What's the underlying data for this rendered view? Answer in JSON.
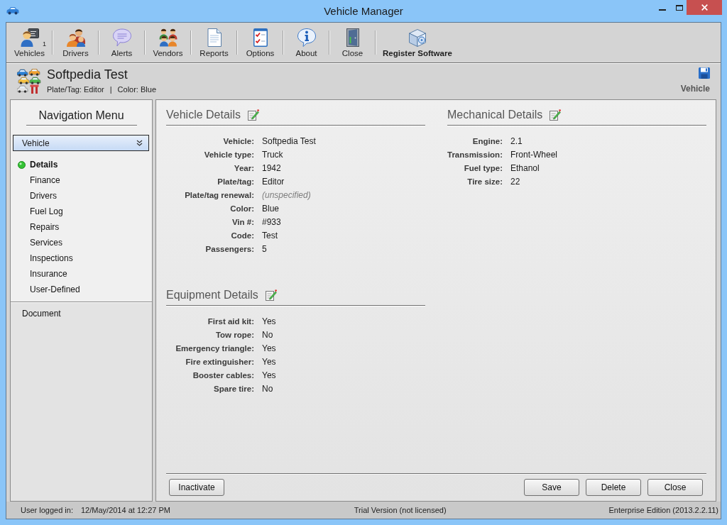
{
  "window": {
    "title": "Vehicle Manager"
  },
  "toolbar": [
    {
      "label": "Vehicles",
      "badge": "1",
      "emphasized": false
    },
    {
      "label": "Drivers",
      "emphasized": false
    },
    {
      "label": "Alerts",
      "emphasized": false
    },
    {
      "label": "Vendors",
      "emphasized": false
    },
    {
      "label": "Reports",
      "emphasized": false
    },
    {
      "label": "Options",
      "emphasized": false
    },
    {
      "label": "About",
      "emphasized": false
    },
    {
      "label": "Close",
      "emphasized": false
    },
    {
      "label": "Register Software",
      "emphasized": true
    }
  ],
  "header": {
    "title": "Softpedia Test",
    "details": [
      "Plate/Tag: Editor",
      "Color: Blue"
    ],
    "separator": "|",
    "context": "Vehicle"
  },
  "sidebar": {
    "title": "Navigation Menu",
    "dropdown": {
      "value": "Vehicle"
    },
    "items": [
      {
        "label": "Details",
        "selected": true
      },
      {
        "label": "Finance",
        "selected": false
      },
      {
        "label": "Drivers",
        "selected": false
      },
      {
        "label": "Fuel Log",
        "selected": false
      },
      {
        "label": "Repairs",
        "selected": false
      },
      {
        "label": "Services",
        "selected": false
      },
      {
        "label": "Inspections",
        "selected": false
      },
      {
        "label": "Insurance",
        "selected": false
      },
      {
        "label": "User-Defined",
        "selected": false
      }
    ],
    "footer_items": [
      {
        "label": "Document",
        "selected": false
      }
    ]
  },
  "detail_columns": [
    {
      "sections": [
        {
          "title": "Vehicle Details",
          "fields": [
            {
              "label": "Vehicle:",
              "value": "Softpedia Test",
              "kind": "value"
            },
            {
              "label": "Vehicle type:",
              "value": "Truck",
              "kind": "value"
            },
            {
              "label": "Year:",
              "value": "1942",
              "kind": "value"
            },
            {
              "label": "Plate/tag:",
              "value": "Editor",
              "kind": "value"
            },
            {
              "label": "Plate/tag renewal:",
              "value": "(unspecified)",
              "kind": "unset"
            },
            {
              "label": "Color:",
              "value": "Blue",
              "kind": "value"
            },
            {
              "label": "Vin #:",
              "value": "#933",
              "kind": "value"
            },
            {
              "label": "Code:",
              "value": "Test",
              "kind": "value"
            },
            {
              "label": "Passengers:",
              "value": "5",
              "kind": "value"
            }
          ]
        },
        {
          "title": "Equipment Details",
          "fields": [
            {
              "label": "First aid kit:",
              "value": "Yes",
              "kind": "value"
            },
            {
              "label": "Tow rope:",
              "value": "No",
              "kind": "value"
            },
            {
              "label": "Emergency triangle:",
              "value": "Yes",
              "kind": "value"
            },
            {
              "label": "Fire extinguisher:",
              "value": "Yes",
              "kind": "value"
            },
            {
              "label": "Booster cables:",
              "value": "Yes",
              "kind": "value"
            },
            {
              "label": "Spare tire:",
              "value": "No",
              "kind": "value"
            }
          ]
        }
      ]
    },
    {
      "sections": [
        {
          "title": "Mechanical Details",
          "fields": [
            {
              "label": "Engine:",
              "value": "2.1",
              "kind": "value"
            },
            {
              "label": "Transmission:",
              "value": "Front-Wheel",
              "kind": "value"
            },
            {
              "label": "Fuel type:",
              "value": "Ethanol",
              "kind": "value"
            },
            {
              "label": "Tire size:",
              "value": "22",
              "kind": "value"
            }
          ]
        }
      ]
    }
  ],
  "footer": {
    "left_buttons": [
      "Inactivate"
    ],
    "right_buttons": [
      "Save",
      "Delete",
      "Close"
    ]
  },
  "status_bar": {
    "user_label": "User logged in:",
    "user_value": "12/May/2014 at 12:27 PM",
    "license": "Trial Version (not licensed)",
    "edition": "Enterprise Edition (2013.2.2.11)"
  }
}
